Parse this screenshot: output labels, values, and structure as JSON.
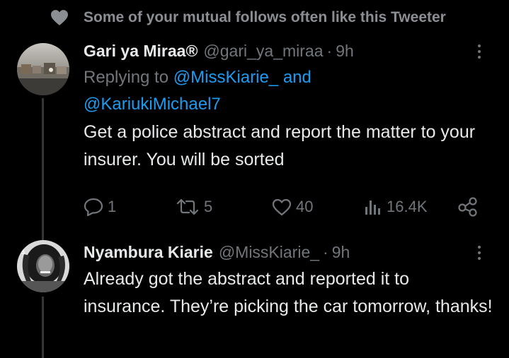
{
  "social_context": {
    "text": "Some of your mutual follows often like this Tweeter",
    "icon": "heart-icon"
  },
  "tweets": [
    {
      "display_name": "Gari ya Miraa®",
      "handle": "@gari_ya_miraa",
      "separator": "·",
      "time": "9h",
      "replying_prefix": "Replying to",
      "mention_1": "@MissKiarie_",
      "mention_and": "and",
      "mention_2": "@KariukiMichael7",
      "text": "Get a police abstract and report the matter to your insurer. You will be sorted",
      "actions": {
        "replies": "1",
        "retweets": "5",
        "likes": "40",
        "views": "16.4K"
      }
    },
    {
      "display_name": "Nyambura Kiarie",
      "handle": "@MissKiarie_",
      "separator": "·",
      "time": "9h",
      "text": "Already got the abstract and reported it to insurance. They’re picking the car tomorrow, thanks!"
    }
  ],
  "colors": {
    "background": "#000000",
    "text_primary": "#e7e9ea",
    "text_secondary": "#71767b",
    "accent": "#1d9bf0"
  }
}
